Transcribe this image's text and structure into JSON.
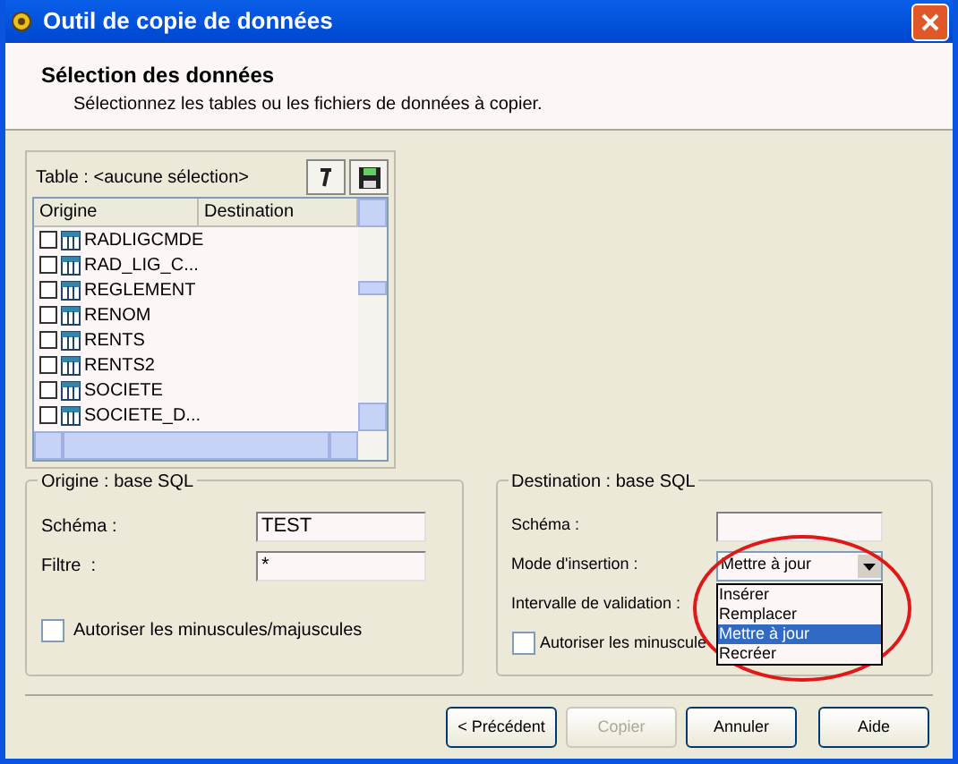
{
  "window": {
    "title": "Outil de copie de données"
  },
  "header": {
    "title": "Sélection des données",
    "subtitle": "Sélectionnez les tables ou les fichiers de données à copier."
  },
  "table_panel": {
    "label": "Table : <aucune sélection>",
    "columns": [
      "Origine",
      "Destination"
    ],
    "rows": [
      {
        "name": "RADLIGCMDE",
        "checked": false
      },
      {
        "name": "RAD_LIG_C...",
        "checked": false
      },
      {
        "name": "REGLEMENT",
        "checked": false
      },
      {
        "name": "RENOM",
        "checked": false
      },
      {
        "name": "RENTS",
        "checked": false
      },
      {
        "name": "RENTS2",
        "checked": false
      },
      {
        "name": "SOCIETE",
        "checked": false
      },
      {
        "name": "SOCIETE_D...",
        "checked": false
      }
    ]
  },
  "origin_group": {
    "title": "Origine : base SQL",
    "schema_label": "Schéma :",
    "schema_value": "TEST",
    "filter_label": "Filtre  :",
    "filter_value": "*",
    "case_checkbox": {
      "label": "Autoriser les minuscules/majuscules",
      "checked": false
    }
  },
  "destination_group": {
    "title": "Destination : base SQL",
    "schema_label": "Schéma :",
    "mode_label": "Mode d'insertion :",
    "mode_value": "Mettre à jour",
    "interval_label": "Intervalle de validation :",
    "case_checkbox": {
      "label": "Autoriser les minuscule",
      "checked": false
    },
    "mode_options": [
      {
        "label": "Insérer",
        "selected": false
      },
      {
        "label": "Remplacer",
        "selected": false
      },
      {
        "label": "Mettre à jour",
        "selected": true
      },
      {
        "label": "Recréer",
        "selected": false
      }
    ]
  },
  "buttons": [
    {
      "label": "< Précédent",
      "disabled": false
    },
    {
      "label": "Copier",
      "disabled": true
    },
    {
      "label": "Annuler",
      "disabled": false
    },
    {
      "label": "Aide",
      "disabled": false
    }
  ]
}
